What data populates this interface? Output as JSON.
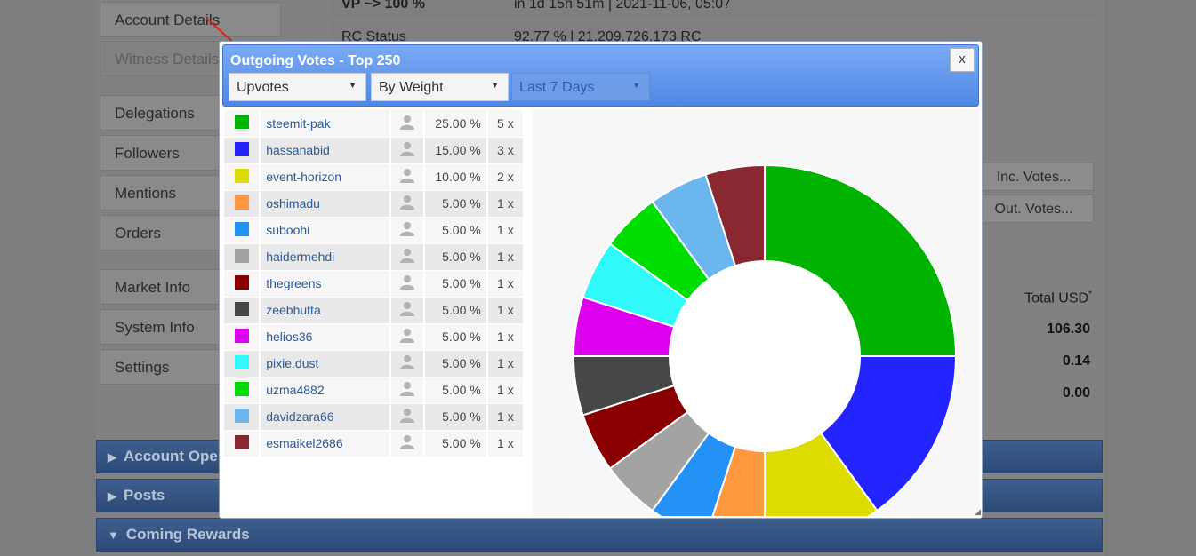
{
  "background": {
    "sidebar": [
      "Account Details",
      "Witness Details",
      "Delegations",
      "Followers",
      "Mentions",
      "Orders",
      "Market Info",
      "System Info",
      "Settings"
    ],
    "rows": [
      {
        "label": "VP ~> 100 %",
        "value": "in 1d 15h 51m  |  2021-11-06, 05:07"
      },
      {
        "label": "RC Status",
        "value": "92.77 %  |  21,209,726,173 RC"
      }
    ],
    "buttons": [
      "Inc. Votes...",
      "Out. Votes..."
    ],
    "total_header": "Total USD",
    "total_mark": "*",
    "totals": [
      "106.30",
      "0.14",
      "0.00"
    ],
    "sections": [
      "Account Opera",
      "Posts",
      "Coming Rewards"
    ]
  },
  "modal": {
    "title": "Outgoing Votes - Top 250",
    "close_label": "x",
    "filters": {
      "type": "Upvotes",
      "sort": "By Weight",
      "period": "Last 7 Days"
    }
  },
  "votes": [
    {
      "name": "steemit-pak",
      "pct": "25.00 %",
      "count": "5 x",
      "color": "#00b300"
    },
    {
      "name": "hassanabid",
      "pct": "15.00 %",
      "count": "3 x",
      "color": "#2424ff"
    },
    {
      "name": "event-horizon",
      "pct": "10.00 %",
      "count": "2 x",
      "color": "#dcdc00"
    },
    {
      "name": "oshimadu",
      "pct": "5.00 %",
      "count": "1 x",
      "color": "#ff9940"
    },
    {
      "name": "suboohi",
      "pct": "5.00 %",
      "count": "1 x",
      "color": "#2391f5"
    },
    {
      "name": "haidermehdi",
      "pct": "5.00 %",
      "count": "1 x",
      "color": "#a3a3a3"
    },
    {
      "name": "thegreens",
      "pct": "5.00 %",
      "count": "1 x",
      "color": "#8a0000"
    },
    {
      "name": "zeebhutta",
      "pct": "5.00 %",
      "count": "1 x",
      "color": "#474747"
    },
    {
      "name": "helios36",
      "pct": "5.00 %",
      "count": "1 x",
      "color": "#dd00ee"
    },
    {
      "name": "pixie.dust",
      "pct": "5.00 %",
      "count": "1 x",
      "color": "#2ff9f9"
    },
    {
      "name": "uzma4882",
      "pct": "5.00 %",
      "count": "1 x",
      "color": "#00dd00"
    },
    {
      "name": "davidzara66",
      "pct": "5.00 %",
      "count": "1 x",
      "color": "#6cb6f0"
    },
    {
      "name": "esmaikel2686",
      "pct": "5.00 %",
      "count": "1 x",
      "color": "#8a2832"
    }
  ],
  "chart_data": {
    "type": "pie",
    "variant": "donut",
    "categories": [
      "steemit-pak",
      "hassanabid",
      "event-horizon",
      "oshimadu",
      "suboohi",
      "haidermehdi",
      "thegreens",
      "zeebhutta",
      "helios36",
      "pixie.dust",
      "uzma4882",
      "davidzara66",
      "esmaikel2686"
    ],
    "values": [
      25,
      15,
      10,
      5,
      5,
      5,
      5,
      5,
      5,
      5,
      5,
      5,
      5
    ],
    "colors": [
      "#00b300",
      "#2424ff",
      "#dcdc00",
      "#ff9940",
      "#2391f5",
      "#a3a3a3",
      "#8a0000",
      "#474747",
      "#dd00ee",
      "#2ff9f9",
      "#00dd00",
      "#6cb6f0",
      "#8a2832"
    ]
  },
  "icons": {
    "user": "user-icon",
    "dropdown": "dropdown-arrow-icon",
    "section": "triangle-icon",
    "resize": "resize-grip-icon"
  }
}
